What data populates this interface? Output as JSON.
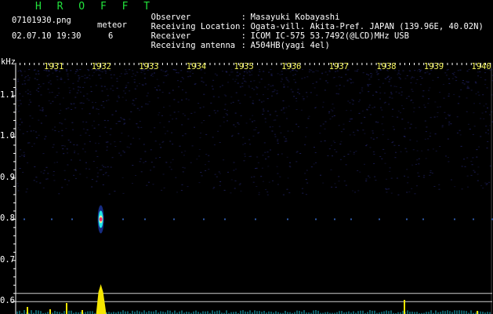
{
  "app": {
    "title": "H R O F F T"
  },
  "file": {
    "name": "07101930.png",
    "datetime": "02.07.10 19:30"
  },
  "meteor": {
    "label": "meteor",
    "count": "6"
  },
  "metadata": [
    {
      "key": "Observer",
      "value": "Masayuki Kobayashi"
    },
    {
      "key": "Receiving Location",
      "value": "Ogata-vill. Akita-Pref. JAPAN (139.96E, 40.02N)"
    },
    {
      "key": "Receiver",
      "value": "ICOM IC-575 53.7492(@LCD)MHz USB"
    },
    {
      "key": "Receiving antenna",
      "value": "A504HB(yagi 4el)"
    }
  ],
  "colors": {
    "title": "#22e23c",
    "ticks": "#f2f25a",
    "noise": "#22246a",
    "echo_core": "#ff2a6a",
    "echo_mid": "#20e8e8"
  },
  "chart_data": {
    "type": "heatmap",
    "ylabel": "kHz",
    "x_ticks": [
      "1931",
      "1932",
      "1933",
      "1934",
      "1935",
      "1936",
      "1937",
      "1938",
      "1939",
      "1940"
    ],
    "y_ticks": [
      "1.1",
      "1.0",
      "0.9",
      "0.8",
      "0.7",
      "0.6"
    ],
    "ylim": [
      0.57,
      1.18
    ],
    "xlim": [
      "19:30:00",
      "19:40:30"
    ],
    "events": [
      {
        "time_min": 1932.0,
        "freq_khz": 0.8,
        "intensity": "strong"
      }
    ],
    "carrier_freq_khz": 0.8,
    "horizontal_lines_khz": [
      0.62,
      0.6
    ]
  }
}
